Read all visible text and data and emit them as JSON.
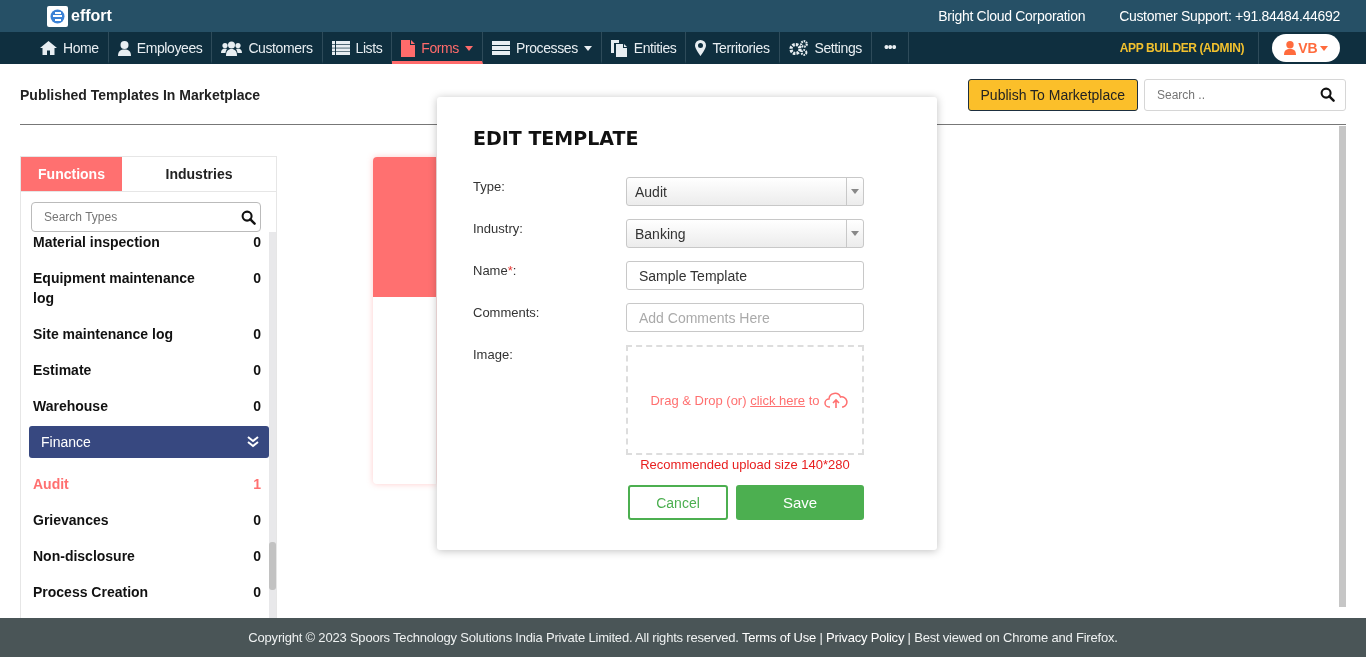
{
  "header": {
    "app_name": "effort",
    "company": "Bright Cloud Corporation",
    "support": "Customer Support: +91.84484.44692"
  },
  "nav": {
    "items": [
      {
        "label": "Home",
        "selected": false,
        "has_menu": false
      },
      {
        "label": "Employees",
        "selected": false,
        "has_menu": false
      },
      {
        "label": "Customers",
        "selected": false,
        "has_menu": false
      },
      {
        "label": "Lists",
        "selected": false,
        "has_menu": false
      },
      {
        "label": "Forms",
        "selected": true,
        "has_menu": true
      },
      {
        "label": "Processes",
        "selected": false,
        "has_menu": true
      },
      {
        "label": "Entities",
        "selected": false,
        "has_menu": false
      },
      {
        "label": "Territories",
        "selected": false,
        "has_menu": false
      },
      {
        "label": "Settings",
        "selected": false,
        "has_menu": false
      }
    ],
    "more": "•••",
    "role": "APP BUILDER (ADMIN)",
    "user_initials": "VB"
  },
  "page": {
    "title": "Published Templates In Marketplace",
    "publish_button": "Publish To Marketplace",
    "search": {
      "placeholder": "Search .."
    }
  },
  "sidebar": {
    "tabs": [
      {
        "label": "Functions",
        "selected": true
      },
      {
        "label": "Industries",
        "selected": false
      }
    ],
    "search": {
      "placeholder": "Search Types"
    },
    "items": [
      {
        "kind": "item",
        "label": "Material inspection",
        "count": "0",
        "selected": false
      },
      {
        "kind": "item",
        "label": "Equipment maintenance log",
        "count": "0",
        "selected": false
      },
      {
        "kind": "item",
        "label": "Site maintenance log",
        "count": "0",
        "selected": false
      },
      {
        "kind": "item",
        "label": "Estimate",
        "count": "0",
        "selected": false
      },
      {
        "kind": "item",
        "label": "Warehouse",
        "count": "0",
        "selected": false
      },
      {
        "kind": "group",
        "label": "Finance",
        "expanded": true,
        "children": [
          {
            "kind": "item",
            "label": "Audit",
            "count": "1",
            "selected": true
          },
          {
            "kind": "item",
            "label": "Grievances",
            "count": "0",
            "selected": false
          },
          {
            "kind": "item",
            "label": "Non-disclosure",
            "count": "0",
            "selected": false
          },
          {
            "kind": "item",
            "label": "Process Creation",
            "count": "0",
            "selected": false
          }
        ]
      }
    ]
  },
  "modal": {
    "title": "EDIT TEMPLATE",
    "fields": [
      {
        "kind": "select",
        "label": "Type:",
        "value": "Audit"
      },
      {
        "kind": "select",
        "label": "Industry:",
        "value": "Banking"
      },
      {
        "kind": "text",
        "label": "Name",
        "required_mark": "*",
        "label_end": ":",
        "value": "Sample Template"
      },
      {
        "kind": "text",
        "label": "Comments:",
        "placeholder": "Add Comments Here"
      },
      {
        "kind": "upload",
        "label": "Image:",
        "hint_before": "Drag & Drop (or)",
        "link": "click here",
        "hint_after": "to",
        "note": "Recommended upload size 140*280"
      }
    ],
    "buttons": [
      {
        "kind": "secondary",
        "label": "Cancel"
      },
      {
        "kind": "primary",
        "label": "Save"
      }
    ]
  },
  "footer": {
    "parts": [
      {
        "kind": "text",
        "text": "Copyright © 2023 Spoors Technology Solutions India Private Limited. All rights reserved."
      },
      {
        "kind": "link",
        "text": "Terms of Use"
      },
      {
        "kind": "text",
        "text": "|"
      },
      {
        "kind": "link",
        "text": "Privacy Policy"
      },
      {
        "kind": "text",
        "text": "| Best viewed on Chrome and Firefox."
      }
    ]
  }
}
